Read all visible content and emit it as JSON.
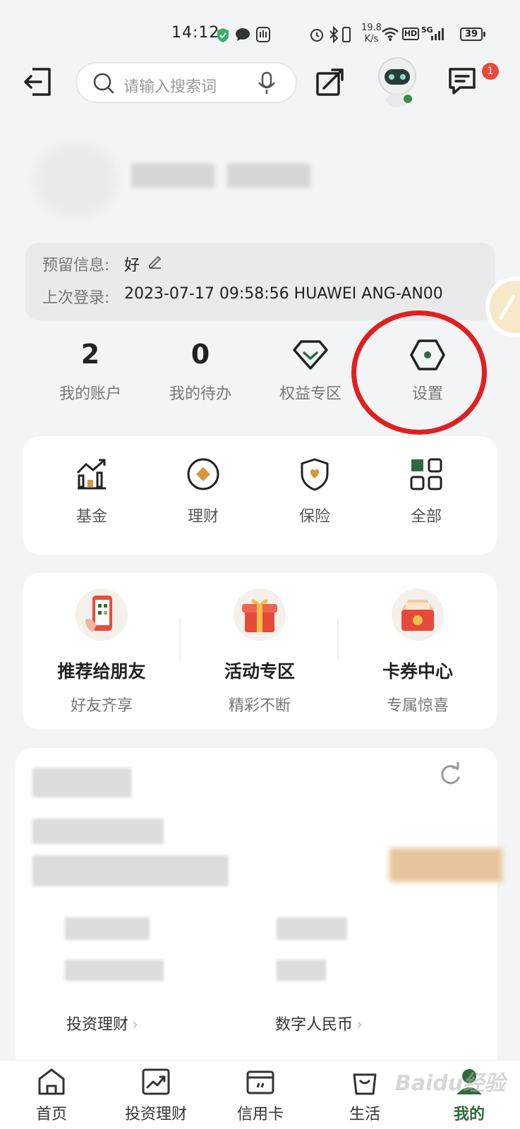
{
  "status_bar": {
    "time": "14:12",
    "net_speed_value": "19.8",
    "net_speed_unit": "K/s",
    "hd": "HD",
    "signal": "5G",
    "battery": "39"
  },
  "top_bar": {
    "search_placeholder": "请输入搜索词",
    "notification_count": "1"
  },
  "info": {
    "reserved_label": "预留信息:",
    "reserved_value": "好",
    "last_login_label": "上次登录:",
    "last_login_value": "2023-07-17 09:58:56 HUAWEI ANG-AN00"
  },
  "stats": [
    {
      "value": "2",
      "label": "我的账户"
    },
    {
      "value": "0",
      "label": "我的待办"
    },
    {
      "label": "权益专区",
      "icon": "diamond-icon"
    },
    {
      "label": "设置",
      "icon": "settings-hex-icon"
    }
  ],
  "products": [
    {
      "label": "基金",
      "icon": "fund-chart-icon"
    },
    {
      "label": "理财",
      "icon": "wealth-coin-icon"
    },
    {
      "label": "保险",
      "icon": "insurance-shield-icon"
    },
    {
      "label": "全部",
      "icon": "grid-all-icon"
    }
  ],
  "promos": [
    {
      "title": "推荐给朋友",
      "subtitle": "好友齐享",
      "icon": "phone-qr-icon"
    },
    {
      "title": "活动专区",
      "subtitle": "精彩不断",
      "icon": "gift-box-icon"
    },
    {
      "title": "卡券中心",
      "subtitle": "专属惊喜",
      "icon": "coupon-box-icon"
    }
  ],
  "links": [
    {
      "label": "投资理财"
    },
    {
      "label": "数字人民币"
    }
  ],
  "nav": [
    {
      "label": "首页",
      "icon": "home-icon"
    },
    {
      "label": "投资理财",
      "icon": "trend-chart-icon"
    },
    {
      "label": "信用卡",
      "icon": "credit-card-icon"
    },
    {
      "label": "生活",
      "icon": "shopping-bag-icon"
    },
    {
      "label": "我的",
      "icon": "profile-icon",
      "active": true
    }
  ],
  "watermark": "Baidu经验",
  "colors": {
    "accent": "#2f6b3a",
    "highlight": "#e02020",
    "badge": "#e84a3a",
    "gold": "#d8973a"
  }
}
